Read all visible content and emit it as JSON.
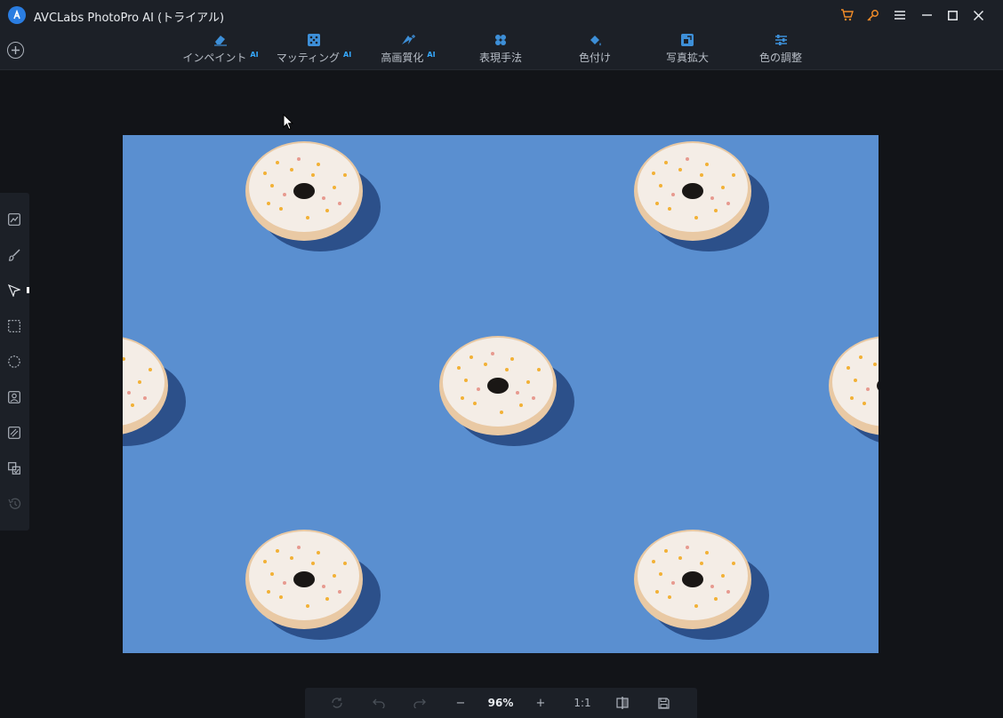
{
  "app": {
    "title": "AVCLabs PhotoPro AI (トライアル)"
  },
  "window_controls": [
    "cart-icon",
    "key-icon",
    "menu-icon",
    "minimize-icon",
    "maximize-icon",
    "close-icon"
  ],
  "toolbar": {
    "add_icon": "plus-circle-icon",
    "tools": [
      {
        "label": "インペイント",
        "ai": "AI",
        "icon": "eraser-icon"
      },
      {
        "label": "マッティング",
        "ai": "AI",
        "icon": "matting-icon"
      },
      {
        "label": "高画質化",
        "ai": "AI",
        "icon": "enhance-icon"
      },
      {
        "label": "表現手法",
        "ai": "",
        "icon": "style-icon"
      },
      {
        "label": "色付け",
        "ai": "",
        "icon": "colorize-icon"
      },
      {
        "label": "写真拡大",
        "ai": "",
        "icon": "upscale-icon"
      },
      {
        "label": "色の調整",
        "ai": "",
        "icon": "sliders-icon"
      }
    ]
  },
  "left_tools": [
    "chart-icon",
    "brush-icon",
    "select-arrow-icon",
    "rect-select-icon",
    "ellipse-select-icon",
    "portrait-icon",
    "diagonal-icon",
    "compare-icon",
    "history-icon"
  ],
  "canvas": {
    "image": "donuts-on-blue-background",
    "background_color": "#5a8fd0"
  },
  "zoombar": {
    "zoom": "96%",
    "ratio": "1:1",
    "minus": "−",
    "plus": "+"
  },
  "colors": {
    "accent": "#35a9ff",
    "orange": "#f08c28",
    "panel": "#1c2027",
    "background": "#121418"
  }
}
